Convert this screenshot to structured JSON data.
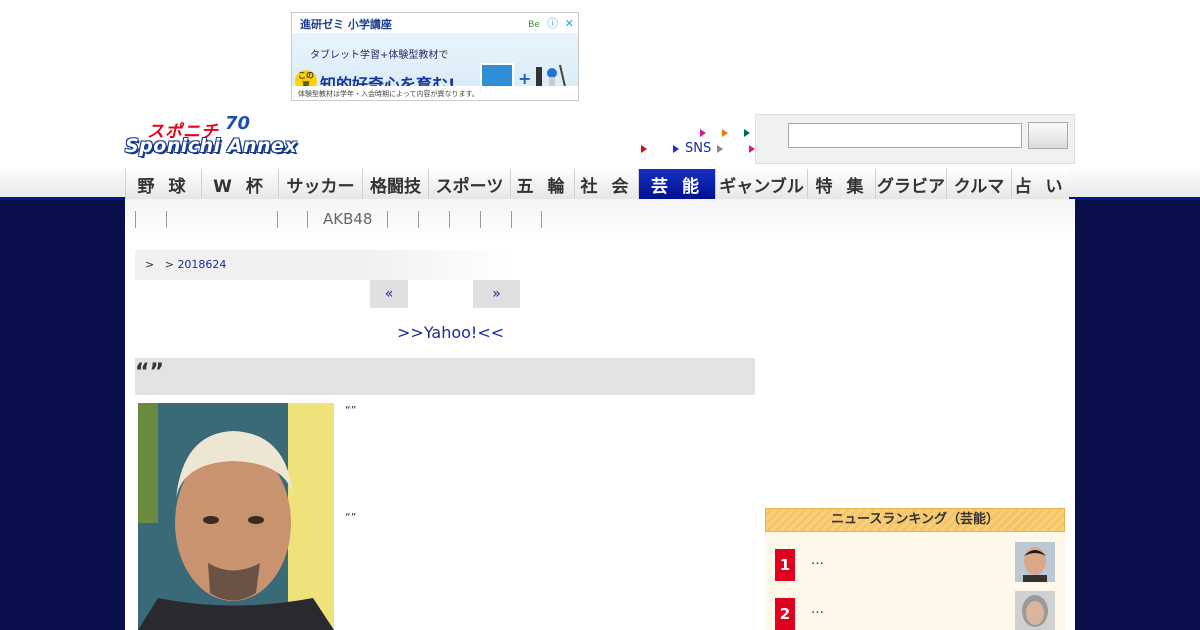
{
  "ad": {
    "brand": "進研ゼミ 小学講座",
    "bee_logo": "Be",
    "line1": "タブレット学習+体験型教材で",
    "badge": "この夏",
    "main": "知的好奇心を育む!",
    "plus": "+",
    "footnote": "体験型教材は学年・入会時期によって内容が異なります。",
    "info_icon": "ⓘ",
    "close_icon": "✕"
  },
  "logo": {
    "top": "スポニチ",
    "anniversary": "70",
    "bottom": "Sponichi Annex"
  },
  "header_links": {
    "sns_label": "SNS"
  },
  "search": {
    "placeholder": ""
  },
  "nav": {
    "items": [
      {
        "label": "野 球",
        "active": false
      },
      {
        "label": "W 杯",
        "active": false
      },
      {
        "label": "サッカー",
        "active": false
      },
      {
        "label": "格闘技",
        "active": false
      },
      {
        "label": "スポーツ",
        "active": false
      },
      {
        "label": "五 輪",
        "active": false
      },
      {
        "label": "社 会",
        "active": false
      },
      {
        "label": "芸 能",
        "active": true
      },
      {
        "label": "ギャンブル",
        "active": false
      },
      {
        "label": "特 集",
        "active": false
      },
      {
        "label": "グラビア",
        "active": false
      },
      {
        "label": "クルマ",
        "active": false
      },
      {
        "label": "占 い",
        "active": false
      }
    ]
  },
  "subnav": {
    "akb_label": "AKB48"
  },
  "breadcrumb": {
    "sep1": ">",
    "sep2": ">",
    "date": "2018624"
  },
  "pager": {
    "prev": "«",
    "next": "»"
  },
  "yahoo_link": ">>Yahoo!<<",
  "article": {
    "title": "“”",
    "caption1": "“”",
    "caption2": "“”"
  },
  "ranking": {
    "heading": "ニュースランキング（芸能）",
    "items": [
      {
        "rank": "1",
        "text": "…"
      },
      {
        "rank": "2",
        "text": "…"
      }
    ]
  },
  "colors": {
    "navy_background": "#0a0f4c",
    "active_nav": "#001090",
    "link_blue": "#1a2a9c",
    "rank_red": "#e0001f",
    "ranking_header": "#f8cf7c"
  }
}
